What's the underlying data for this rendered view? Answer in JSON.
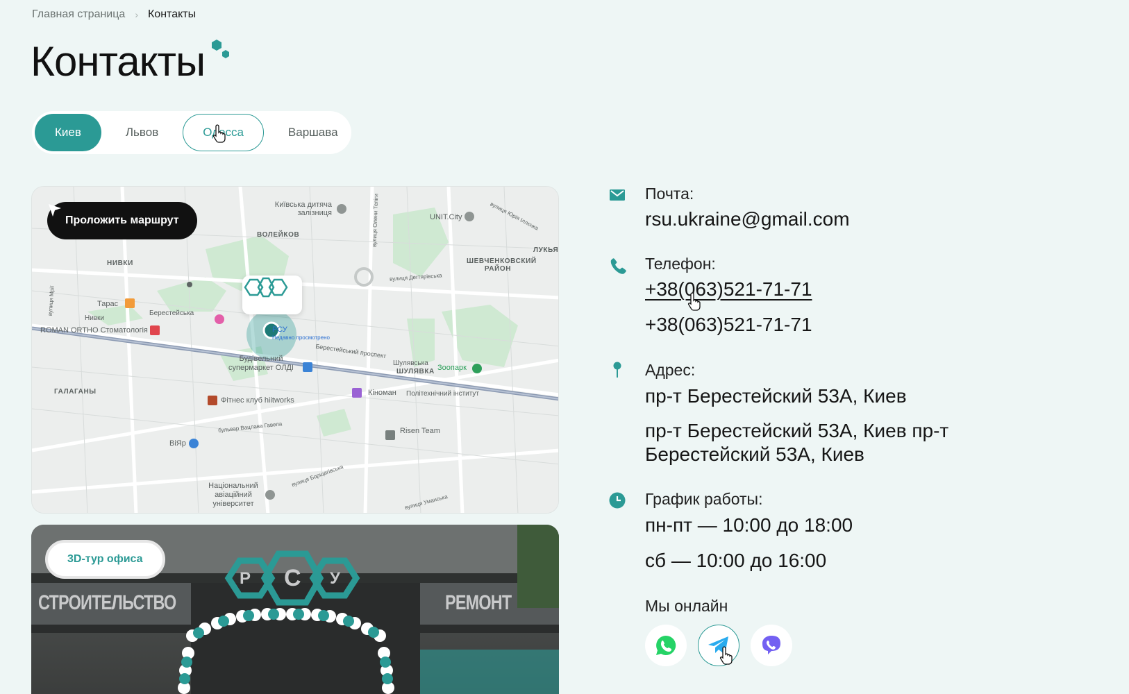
{
  "breadcrumb": {
    "home": "Главная страница",
    "current": "Контакты"
  },
  "page_title": "Контакты",
  "city_tabs": [
    {
      "label": "Киев",
      "state": "active"
    },
    {
      "label": "Львов",
      "state": "default"
    },
    {
      "label": "Одесса",
      "state": "hover"
    },
    {
      "label": "Варшава",
      "state": "default"
    }
  ],
  "map": {
    "route_button": "Проложить маршрут",
    "marker_label": "РСУ",
    "marker_sub": "Недавно просмотрено",
    "labels": {
      "railway": "Київська дитяча залізниця",
      "volieikov": "ВОЛЕЙКОВ",
      "unit_city": "UNIT.City",
      "lukya": "ЛУКЬЯ",
      "shevchenko": "ШЕВЧЕНКОВСКИЙ РАЙОН",
      "nyvky": "НИВКИ",
      "taras": "Тарас",
      "berest": "Берестейська",
      "nyvky2": "Нивки",
      "roman_ortho": "ROMAN ORTHO Стоматологія",
      "olda": "Будівельний супермаркет ОЛДІ",
      "shuliavka": "Шулявська",
      "shuliavka2": "ШУЛЯВКА",
      "zoopark": "Зоопарк",
      "galagany": "ГАЛАГАНЫ",
      "fitnes": "Фітнес клуб hiitworks",
      "kinoman": "Кіноман",
      "poly": "Політехнічний інститут",
      "risen": "Risen Team",
      "viyar": "ВіЯр",
      "aviation": "Національний авіаційний університет",
      "prospekt": "Берестейський проспект",
      "havel": "бульвар Вацлава Гавела",
      "degtiar": "вулиця Дегтярівська",
      "olena": "вулиця Олени Теліги",
      "borsh": "вулиця Борщагівська",
      "mira": "вулиця Мрії",
      "yulia": "вулиця Юрія Іллєнка",
      "umanska": "вулиця Уманська"
    }
  },
  "tour": {
    "button": "3D-тур офиса",
    "sign_left": "СТРОИТЕЛЬСТВО",
    "sign_right": "РЕМОНТ",
    "logo_letters": [
      "Р",
      "С",
      "У"
    ]
  },
  "contacts": {
    "email_label": "Почта:",
    "email": "rsu.ukraine@gmail.com",
    "phone_label": "Телефон:",
    "phone_1": "+38(063)521-71-71",
    "phone_2": "+38(063)521-71-71",
    "address_label": "Адрес:",
    "address_1": "пр-т Берестейский 53А, Киев",
    "address_2": "пр-т Берестейский 53А, Киев пр-т Берестейский 53А, Киев",
    "schedule_label": "График работы:",
    "schedule_1": "пн-пт — 10:00 до 18:00",
    "schedule_2": "сб — 10:00 до 16:00",
    "online_label": "Мы онлайн"
  },
  "messengers": [
    {
      "name": "whatsapp",
      "color": "#25D366"
    },
    {
      "name": "telegram",
      "color": "#2AABEE"
    },
    {
      "name": "viber",
      "color": "#7360F2"
    }
  ],
  "colors": {
    "accent": "#2b9a95",
    "background": "#eef6f5",
    "dark_button": "#111111"
  }
}
